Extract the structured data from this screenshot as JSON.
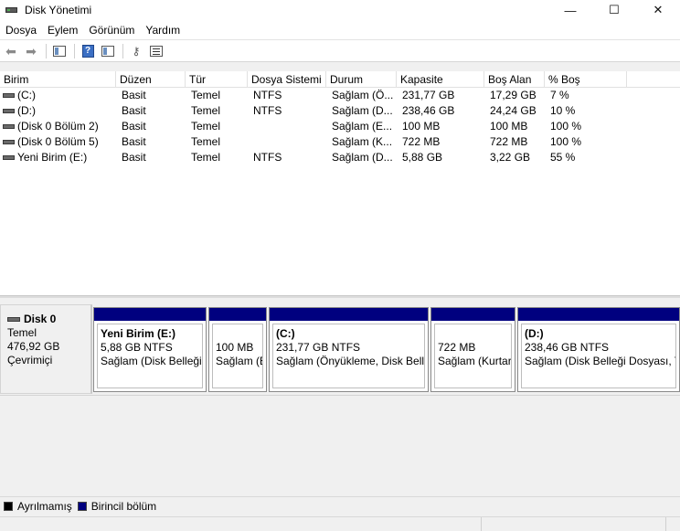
{
  "window": {
    "title": "Disk Yönetimi"
  },
  "menu": [
    "Dosya",
    "Eylem",
    "Görünüm",
    "Yardım"
  ],
  "toolbar": {
    "icons": [
      "back-arrow-icon",
      "forward-arrow-icon",
      "console-tree-icon",
      "help-icon",
      "properties-icon",
      "rescan-key-icon",
      "list-view-icon"
    ]
  },
  "volume_table": {
    "columns": [
      "Birim",
      "Düzen",
      "Tür",
      "Dosya Sistemi",
      "Durum",
      "Kapasite",
      "Boş Alan",
      "% Boş"
    ],
    "rows": [
      [
        "(C:)",
        "Basit",
        "Temel",
        "NTFS",
        "Sağlam (Ö...",
        "231,77 GB",
        "17,29 GB",
        "7 %"
      ],
      [
        "(D:)",
        "Basit",
        "Temel",
        "NTFS",
        "Sağlam (D...",
        "238,46 GB",
        "24,24 GB",
        "10 %"
      ],
      [
        "(Disk 0 Bölüm 2)",
        "Basit",
        "Temel",
        "",
        "Sağlam (E...",
        "100 MB",
        "100 MB",
        "100 %"
      ],
      [
        "(Disk 0 Bölüm 5)",
        "Basit",
        "Temel",
        "",
        "Sağlam (K...",
        "722 MB",
        "722 MB",
        "100 %"
      ],
      [
        "Yeni Birim (E:)",
        "Basit",
        "Temel",
        "NTFS",
        "Sağlam (D...",
        "5,88 GB",
        "3,22 GB",
        "55 %"
      ]
    ]
  },
  "disk": {
    "name": "Disk 0",
    "type": "Temel",
    "size": "476,92 GB",
    "state": "Çevrimiçi"
  },
  "partitions": [
    {
      "name": "Yeni Birim  (E:)",
      "size": "5,88 GB NTFS",
      "status": "Sağlam (Disk Belleği"
    },
    {
      "name": "",
      "size": "100 MB",
      "status": "Sağlam (E"
    },
    {
      "name": "(C:)",
      "size": "231,77 GB NTFS",
      "status": "Sağlam (Önyükleme, Disk Belle"
    },
    {
      "name": "",
      "size": "722 MB",
      "status": "Sağlam (Kurtar"
    },
    {
      "name": "(D:)",
      "size": "238,46 GB NTFS",
      "status": "Sağlam (Disk Belleği Dosyası, Te"
    }
  ],
  "legend": [
    {
      "label": "Ayrılmamış",
      "color": "#000000"
    },
    {
      "label": "Birincil bölüm",
      "color": "#00007f"
    }
  ],
  "colors": {
    "primary_partition_band": "#00007f",
    "unallocated": "#000000"
  }
}
